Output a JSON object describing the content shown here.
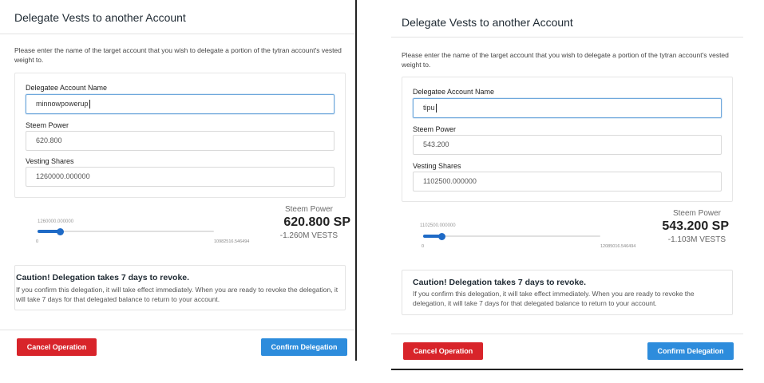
{
  "left": {
    "title": "Delegate Vests to another Account",
    "intro": "Please enter the name of the target account that you wish to delegate a portion of the tytran account's vested weight to.",
    "delegatee_label": "Delegatee Account Name",
    "delegatee_value": "minnowpowerup",
    "steem_power_label": "Steem Power",
    "steem_power_value": "620.800",
    "vesting_label": "Vesting Shares",
    "vesting_value": "1260000.000000",
    "slider_value": "1260000.000000",
    "slider_min": "0",
    "slider_max": "10982516.546494",
    "slider_fraction": 0.115,
    "sp_caption": "Steem Power",
    "sp_big": "620.800 SP",
    "sp_vests": "-1.260M VESTS",
    "caution_title": "Caution! Delegation takes 7 days to revoke.",
    "caution_text": "If you confirm this delegation, it will take effect immediately. When you are ready to revoke the delegation, it will take 7 days for that delegated balance to return to your account.",
    "cancel_label": "Cancel Operation",
    "confirm_label": "Confirm Delegation"
  },
  "right": {
    "title": "Delegate Vests to another Account",
    "intro": "Please enter the name of the target account that you wish to delegate a portion of the tytran account's vested weight to.",
    "delegatee_label": "Delegatee Account Name",
    "delegatee_value": "tipu",
    "steem_power_label": "Steem Power",
    "steem_power_value": "543.200",
    "vesting_label": "Vesting Shares",
    "vesting_value": "1102500.000000",
    "slider_value": "1102500.000000",
    "slider_min": "0",
    "slider_max": "12085016.546494",
    "slider_fraction": 0.091,
    "sp_caption": "Steem Power",
    "sp_big": "543.200 SP",
    "sp_vests": "-1.103M VESTS",
    "caution_title": "Caution! Delegation takes 7 days to revoke.",
    "caution_text": "If you confirm this delegation, it will take effect immediately. When you are ready to revoke the delegation, it will take 7 days for that delegated balance to return to your account.",
    "cancel_label": "Cancel Operation",
    "confirm_label": "Confirm Delegation"
  },
  "colors": {
    "cancel": "#d8242a",
    "confirm": "#2d8cdc",
    "slider": "#1e6ac6"
  }
}
